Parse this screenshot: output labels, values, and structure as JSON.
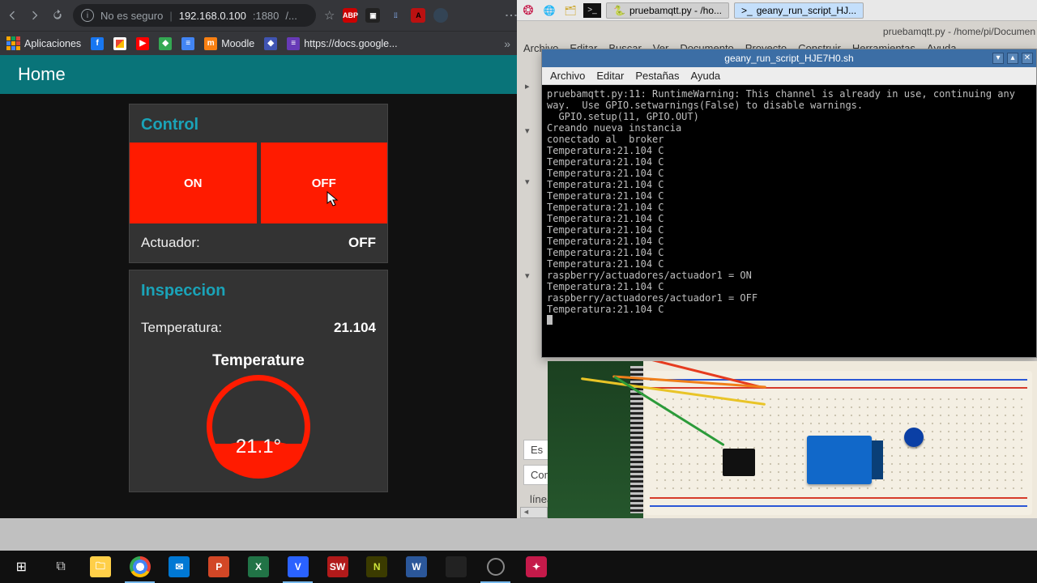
{
  "chrome": {
    "security_label": "No es seguro",
    "url_host": "192.168.0.100",
    "url_port": ":1880",
    "url_rest": "/...",
    "bookmarks": {
      "apps": "Aplicaciones",
      "moodle": "Moodle",
      "docs": "https://docs.google..."
    }
  },
  "dashboard": {
    "page_title": "Home",
    "control": {
      "title": "Control",
      "on": "ON",
      "off": "OFF",
      "actuator_label": "Actuador:",
      "actuator_value": "OFF"
    },
    "inspeccion": {
      "title": "Inspeccion",
      "temp_label": "Temperatura:",
      "temp_value": "21.104",
      "gauge_title": "Temperature",
      "gauge_value": "21.1°"
    }
  },
  "rpi_panel": {
    "task1": "pruebamqtt.py - /ho...",
    "task2": "geany_run_script_HJ..."
  },
  "geany": {
    "title": "pruebamqtt.py - /home/pi/Documen",
    "menu": [
      "Archivo",
      "Editar",
      "Buscar",
      "Ver",
      "Documento",
      "Proyecto",
      "Construir",
      "Herramientas",
      "Ayuda"
    ],
    "bottom1": "Es",
    "bottom2": "Com",
    "bottom3": "línea"
  },
  "terminal": {
    "title": "geany_run_script_HJE7H0.sh",
    "menu": [
      "Archivo",
      "Editar",
      "Pestañas",
      "Ayuda"
    ],
    "lines": [
      "pruebamqtt.py:11: RuntimeWarning: This channel is already in use, continuing any",
      "way.  Use GPIO.setwarnings(False) to disable warnings.",
      "  GPIO.setup(11, GPIO.OUT)",
      "Creando nueva instancia",
      "conectado al  broker",
      "Temperatura:21.104 C",
      "Temperatura:21.104 C",
      "Temperatura:21.104 C",
      "Temperatura:21.104 C",
      "Temperatura:21.104 C",
      "Temperatura:21.104 C",
      "Temperatura:21.104 C",
      "Temperatura:21.104 C",
      "Temperatura:21.104 C",
      "Temperatura:21.104 C",
      "Temperatura:21.104 C",
      "raspberry/actuadores/actuador1 = ON",
      "Temperatura:21.104 C",
      "raspberry/actuadores/actuador1 = OFF",
      "Temperatura:21.104 C"
    ]
  },
  "chart_data": {
    "type": "gauge",
    "title": "Temperature",
    "value": 21.1,
    "unit": "°",
    "min": 0,
    "max": 100
  }
}
